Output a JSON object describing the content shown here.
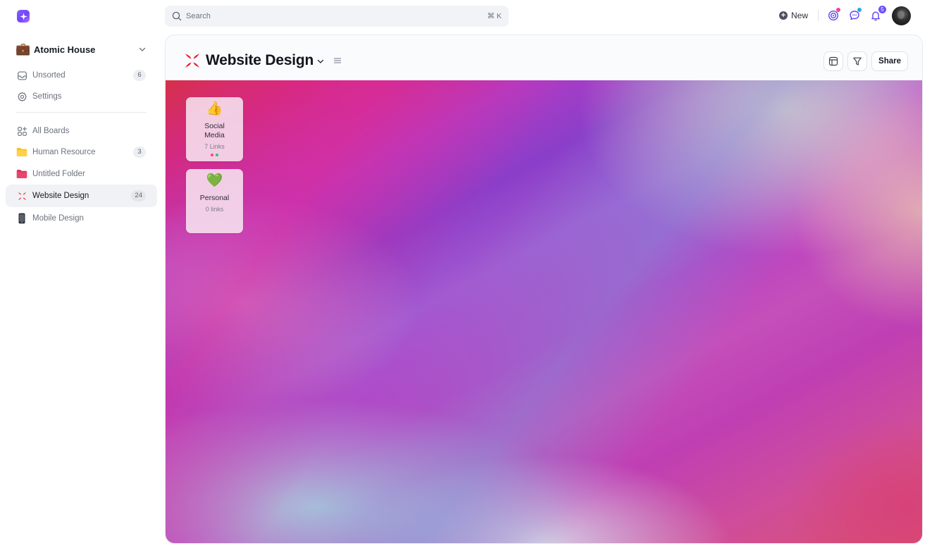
{
  "search": {
    "placeholder": "Search",
    "shortcut": "⌘ K"
  },
  "topbar": {
    "new_label": "New",
    "notifications_count": "5"
  },
  "workspace": {
    "emoji": "💼",
    "name": "Atomic House"
  },
  "sidebar": {
    "items": [
      {
        "label": "Unsorted",
        "icon": "inbox-icon",
        "count": "6"
      },
      {
        "label": "Settings",
        "icon": "gear-icon",
        "count": ""
      },
      {
        "label": "All Boards",
        "icon": "boards-grid-icon",
        "count": ""
      },
      {
        "label": "Human Resource",
        "icon": "folder-yellow-icon",
        "count": "3"
      },
      {
        "label": "Untitled Folder",
        "icon": "folder-pink-icon",
        "count": ""
      },
      {
        "label": "Website Design",
        "icon": "anger-symbol-icon",
        "count": "24",
        "active": true
      },
      {
        "label": "Mobile Design",
        "icon": "mobile-phone-icon",
        "count": ""
      }
    ]
  },
  "board": {
    "title": "Website Design",
    "share_label": "Share"
  },
  "cards": [
    {
      "emoji": "👍",
      "title": "Social Media",
      "subtitle": "7 Links",
      "dots": [
        "#f0478d",
        "#2fc46a"
      ]
    },
    {
      "emoji": "💚",
      "title": "Personal",
      "subtitle": "0 links",
      "dots": []
    }
  ],
  "colors": {
    "accent": "#6b4dff",
    "folder_yellow": "#f7c21b",
    "folder_pink": "#e8466e",
    "anger_red": "#e6202f"
  }
}
